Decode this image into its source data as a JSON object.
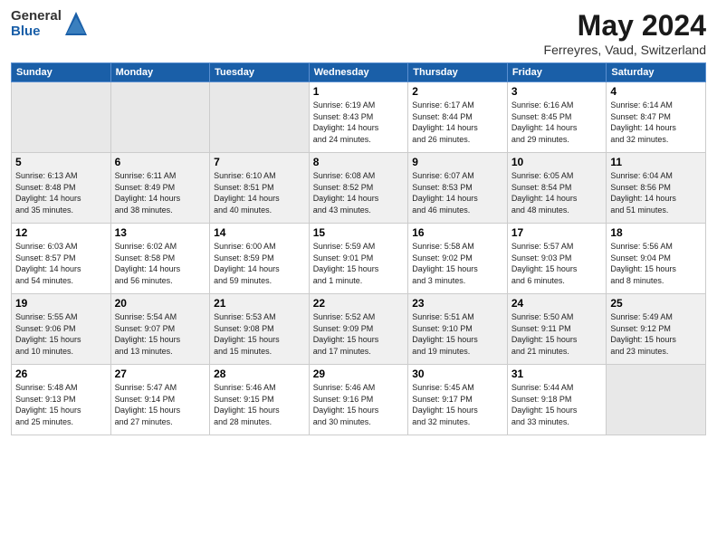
{
  "header": {
    "logo": {
      "text_general": "General",
      "text_blue": "Blue",
      "icon_shape": "triangle"
    },
    "title": "May 2024",
    "subtitle": "Ferreyres, Vaud, Switzerland"
  },
  "weekdays": [
    "Sunday",
    "Monday",
    "Tuesday",
    "Wednesday",
    "Thursday",
    "Friday",
    "Saturday"
  ],
  "weeks": [
    [
      {
        "day": "",
        "info": ""
      },
      {
        "day": "",
        "info": ""
      },
      {
        "day": "",
        "info": ""
      },
      {
        "day": "1",
        "info": "Sunrise: 6:19 AM\nSunset: 8:43 PM\nDaylight: 14 hours\nand 24 minutes."
      },
      {
        "day": "2",
        "info": "Sunrise: 6:17 AM\nSunset: 8:44 PM\nDaylight: 14 hours\nand 26 minutes."
      },
      {
        "day": "3",
        "info": "Sunrise: 6:16 AM\nSunset: 8:45 PM\nDaylight: 14 hours\nand 29 minutes."
      },
      {
        "day": "4",
        "info": "Sunrise: 6:14 AM\nSunset: 8:47 PM\nDaylight: 14 hours\nand 32 minutes."
      }
    ],
    [
      {
        "day": "5",
        "info": "Sunrise: 6:13 AM\nSunset: 8:48 PM\nDaylight: 14 hours\nand 35 minutes."
      },
      {
        "day": "6",
        "info": "Sunrise: 6:11 AM\nSunset: 8:49 PM\nDaylight: 14 hours\nand 38 minutes."
      },
      {
        "day": "7",
        "info": "Sunrise: 6:10 AM\nSunset: 8:51 PM\nDaylight: 14 hours\nand 40 minutes."
      },
      {
        "day": "8",
        "info": "Sunrise: 6:08 AM\nSunset: 8:52 PM\nDaylight: 14 hours\nand 43 minutes."
      },
      {
        "day": "9",
        "info": "Sunrise: 6:07 AM\nSunset: 8:53 PM\nDaylight: 14 hours\nand 46 minutes."
      },
      {
        "day": "10",
        "info": "Sunrise: 6:05 AM\nSunset: 8:54 PM\nDaylight: 14 hours\nand 48 minutes."
      },
      {
        "day": "11",
        "info": "Sunrise: 6:04 AM\nSunset: 8:56 PM\nDaylight: 14 hours\nand 51 minutes."
      }
    ],
    [
      {
        "day": "12",
        "info": "Sunrise: 6:03 AM\nSunset: 8:57 PM\nDaylight: 14 hours\nand 54 minutes."
      },
      {
        "day": "13",
        "info": "Sunrise: 6:02 AM\nSunset: 8:58 PM\nDaylight: 14 hours\nand 56 minutes."
      },
      {
        "day": "14",
        "info": "Sunrise: 6:00 AM\nSunset: 8:59 PM\nDaylight: 14 hours\nand 59 minutes."
      },
      {
        "day": "15",
        "info": "Sunrise: 5:59 AM\nSunset: 9:01 PM\nDaylight: 15 hours\nand 1 minute."
      },
      {
        "day": "16",
        "info": "Sunrise: 5:58 AM\nSunset: 9:02 PM\nDaylight: 15 hours\nand 3 minutes."
      },
      {
        "day": "17",
        "info": "Sunrise: 5:57 AM\nSunset: 9:03 PM\nDaylight: 15 hours\nand 6 minutes."
      },
      {
        "day": "18",
        "info": "Sunrise: 5:56 AM\nSunset: 9:04 PM\nDaylight: 15 hours\nand 8 minutes."
      }
    ],
    [
      {
        "day": "19",
        "info": "Sunrise: 5:55 AM\nSunset: 9:06 PM\nDaylight: 15 hours\nand 10 minutes."
      },
      {
        "day": "20",
        "info": "Sunrise: 5:54 AM\nSunset: 9:07 PM\nDaylight: 15 hours\nand 13 minutes."
      },
      {
        "day": "21",
        "info": "Sunrise: 5:53 AM\nSunset: 9:08 PM\nDaylight: 15 hours\nand 15 minutes."
      },
      {
        "day": "22",
        "info": "Sunrise: 5:52 AM\nSunset: 9:09 PM\nDaylight: 15 hours\nand 17 minutes."
      },
      {
        "day": "23",
        "info": "Sunrise: 5:51 AM\nSunset: 9:10 PM\nDaylight: 15 hours\nand 19 minutes."
      },
      {
        "day": "24",
        "info": "Sunrise: 5:50 AM\nSunset: 9:11 PM\nDaylight: 15 hours\nand 21 minutes."
      },
      {
        "day": "25",
        "info": "Sunrise: 5:49 AM\nSunset: 9:12 PM\nDaylight: 15 hours\nand 23 minutes."
      }
    ],
    [
      {
        "day": "26",
        "info": "Sunrise: 5:48 AM\nSunset: 9:13 PM\nDaylight: 15 hours\nand 25 minutes."
      },
      {
        "day": "27",
        "info": "Sunrise: 5:47 AM\nSunset: 9:14 PM\nDaylight: 15 hours\nand 27 minutes."
      },
      {
        "day": "28",
        "info": "Sunrise: 5:46 AM\nSunset: 9:15 PM\nDaylight: 15 hours\nand 28 minutes."
      },
      {
        "day": "29",
        "info": "Sunrise: 5:46 AM\nSunset: 9:16 PM\nDaylight: 15 hours\nand 30 minutes."
      },
      {
        "day": "30",
        "info": "Sunrise: 5:45 AM\nSunset: 9:17 PM\nDaylight: 15 hours\nand 32 minutes."
      },
      {
        "day": "31",
        "info": "Sunrise: 5:44 AM\nSunset: 9:18 PM\nDaylight: 15 hours\nand 33 minutes."
      },
      {
        "day": "",
        "info": ""
      }
    ]
  ]
}
